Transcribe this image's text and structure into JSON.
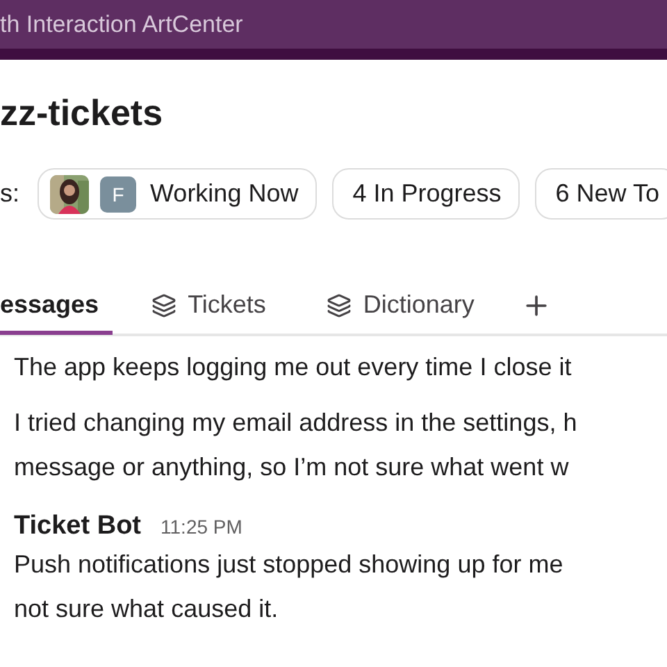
{
  "window": {
    "title": "th Interaction ArtCenter"
  },
  "channel": {
    "name": "zz-tickets"
  },
  "status": {
    "label": "s:",
    "chips": [
      {
        "kind": "avatars",
        "avatars": [
          {
            "kind": "picture"
          },
          {
            "kind": "initial",
            "text": "F"
          }
        ],
        "label": "Working Now"
      },
      {
        "kind": "plain",
        "label": "4 In Progress"
      },
      {
        "kind": "plain",
        "label": "6 New To"
      }
    ]
  },
  "tabs": [
    {
      "label": "essages",
      "selected": true,
      "kind": "plain"
    },
    {
      "label": "Tickets",
      "selected": false,
      "kind": "stack"
    },
    {
      "label": "Dictionary",
      "selected": false,
      "kind": "stack"
    }
  ],
  "messages": [
    {
      "paragraphs": [
        [
          "The app keeps logging me out every time I close it"
        ],
        [
          "I tried changing my email address in the settings, h",
          "message or anything, so I’m not sure what went w"
        ]
      ]
    },
    {
      "author": "Ticket Bot",
      "time": "11:25 PM",
      "paragraphs": [
        [
          "Push notifications just stopped showing up for me",
          "not sure what caused it."
        ]
      ]
    }
  ]
}
